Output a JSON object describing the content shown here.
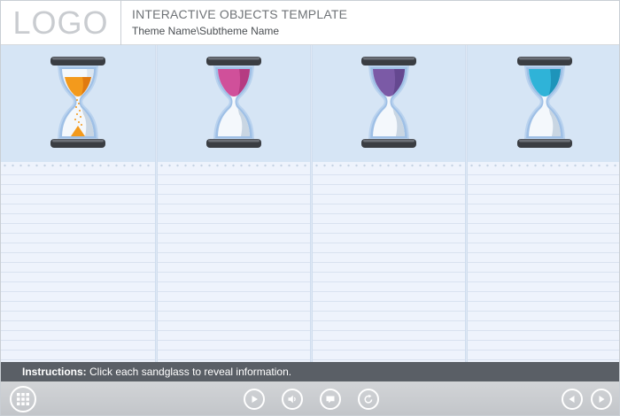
{
  "header": {
    "logo_text": "LOGO",
    "title": "INTERACTIVE OBJECTS TEMPLATE",
    "subtitle": "Theme Name\\Subtheme Name"
  },
  "sandglasses": [
    {
      "name": "orange",
      "sand_color": "#f39a1c",
      "sand_shade": "#e07a10",
      "state": "running"
    },
    {
      "name": "pink",
      "sand_color": "#d0509a",
      "sand_shade": "#b53b82",
      "state": "full"
    },
    {
      "name": "purple",
      "sand_color": "#7b5aa6",
      "sand_shade": "#654890",
      "state": "full"
    },
    {
      "name": "blue",
      "sand_color": "#2fb3d8",
      "sand_shade": "#1e94ba",
      "state": "full"
    }
  ],
  "instructions": {
    "label": "Instructions:",
    "text": " Click each sandglass to reveal information."
  },
  "toolbar": {
    "buttons": [
      "menu-icon",
      "play-icon",
      "volume-icon",
      "captions-icon",
      "replay-icon",
      "previous-icon",
      "next-icon"
    ]
  },
  "colors": {
    "column_top": "#d6e5f5",
    "column_body": "#eef3fc",
    "instructions_bar": "#5a5f66",
    "toolbar": "#c7c9cc"
  }
}
